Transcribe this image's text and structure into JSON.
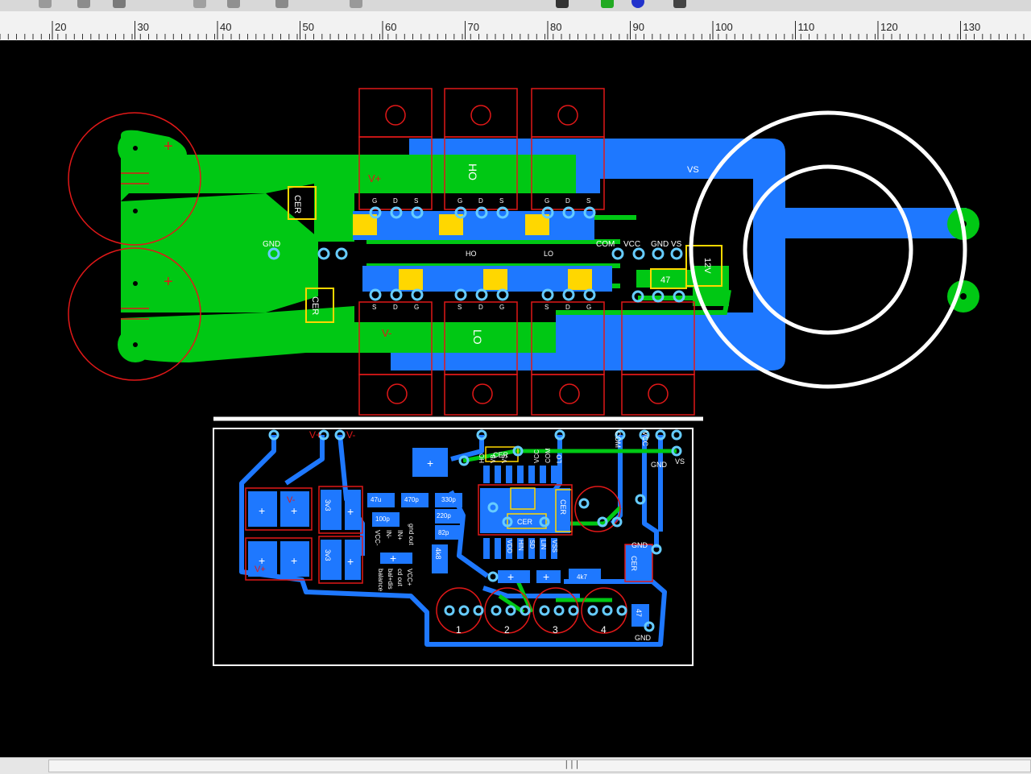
{
  "ruler": {
    "unit_labels": [
      "20",
      "30",
      "40",
      "50",
      "60",
      "70",
      "80",
      "90",
      "100",
      "110",
      "120",
      "130"
    ]
  },
  "toolbar": {
    "icons": [
      "undo-icon",
      "redo-icon",
      "copy-icon",
      "paste-icon",
      "draw-icon",
      "rotate-icon",
      "component-icon",
      "zoom-icon",
      "add-icon",
      "info-icon",
      "grid-icon"
    ]
  },
  "colors": {
    "background": "#000000",
    "top_copper": "#00c814",
    "bottom_copper": "#1e78ff",
    "silkscreen": "#ffffff",
    "component_outline": "#e01818",
    "pad": "#66ccff",
    "smd_pad": "#ffd700"
  },
  "board": {
    "net_labels": {
      "gnd": "GND",
      "com": "COM",
      "vcc": "VCC",
      "gnd2": "GND",
      "vs1": "VS",
      "vs_top": "VS",
      "ho_small": "HO",
      "lo_small": "LO",
      "v_plus": "V+",
      "v_minus": "V-",
      "ho_big": "HO",
      "lo_big": "LO"
    },
    "parts": {
      "cer1": "CER",
      "cer2": "CER",
      "relay": "12V",
      "cap47": "47"
    },
    "mosfet_pins": {
      "gds": [
        "G",
        "D",
        "S"
      ],
      "sdg": [
        "S",
        "D",
        "G"
      ]
    }
  },
  "lower_board": {
    "labels": {
      "vplus": "V+",
      "vminus": "V-",
      "com": "COM",
      "vcc": "VCC",
      "gnd": "GND",
      "vs": "VS",
      "cer_top": "CER",
      "cer_mid": "CER",
      "cer_right": "CER",
      "cer_red": "CER",
      "gnd_r1": "GND",
      "gnd_r2": "GND",
      "v_minus_pad": "V-",
      "v_plus_pad": "V+",
      "c3v3a": "3v3",
      "c3v3b": "3v3",
      "c47u": "47u",
      "c470p": "470p",
      "c100p": "100p",
      "c330p": "330p",
      "c220p": "220p",
      "c82p": "82p",
      "r4k7": "4k7",
      "r4k8": "4k8",
      "c47": "47",
      "vcc_minus": "VCC-",
      "in_minus": "IN-",
      "in_plus": "IN+",
      "v_gnd_out": "gnd out",
      "balance": "balance",
      "bal_plus": "bal+dis",
      "cd_out": "cd out",
      "vcc_plus": "VCC+",
      "ic_top": [
        "HO",
        "VB",
        "VS",
        "VCC",
        "COM",
        "LO"
      ],
      "ic_bottom": [
        "VDD",
        "HIN",
        "SD",
        "LIN",
        "VSS"
      ],
      "conn_nums": [
        "1",
        "2",
        "3",
        "4"
      ]
    }
  }
}
